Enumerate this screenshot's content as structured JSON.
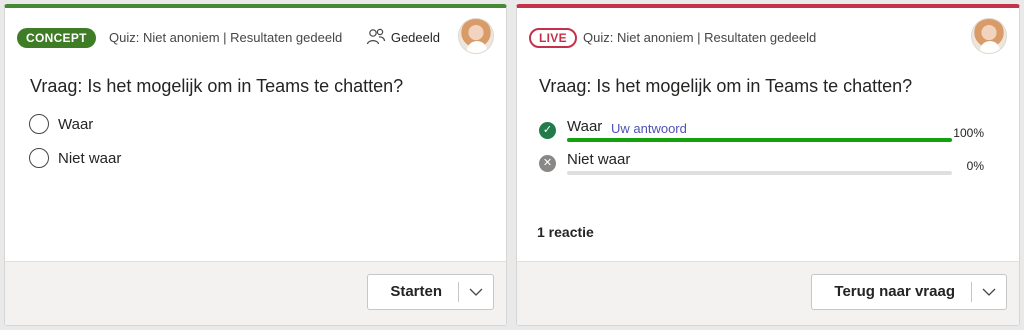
{
  "draft_card": {
    "badge": "CONCEPT",
    "meta": "Quiz: Niet anoniem | Resultaten gedeeld",
    "shared_label": "Gedeeld",
    "question": "Vraag: Is het mogelijk om in Teams te chatten?",
    "options": [
      {
        "label": "Waar"
      },
      {
        "label": "Niet waar"
      }
    ],
    "primary_button": "Starten",
    "accent_color": "#448a34"
  },
  "live_card": {
    "badge": "LIVE",
    "meta": "Quiz: Niet anoniem | Resultaten gedeeld",
    "question": "Vraag: Is het mogelijk om in Teams te chatten?",
    "results": [
      {
        "label": "Waar",
        "tag": "Uw antwoord",
        "percent_text": "100%",
        "percent": 100,
        "correct": true
      },
      {
        "label": "Niet waar",
        "tag": "",
        "percent_text": "0%",
        "percent": 0,
        "correct": false
      }
    ],
    "reactions": "1 reactie",
    "primary_button": "Terug naar vraag",
    "accent_color": "#c4314b"
  },
  "icons": {
    "shared": "people-shared-icon",
    "correct": "check-circle-icon",
    "wrong": "x-circle-icon",
    "caret": "chevron-down-icon"
  }
}
